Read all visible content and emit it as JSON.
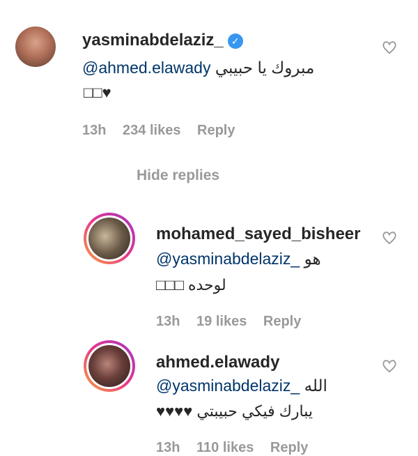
{
  "comments": [
    {
      "username": "yasminabdelaziz_",
      "verified_icon": "verified-badge-icon",
      "line1_mention": "@ahmed.elawady",
      "line1_text": "مبروك يا حبيبي",
      "line2": "□□♥",
      "time": "13h",
      "likes": "234 likes",
      "reply": "Reply"
    },
    {
      "username": "mohamed_sayed_bisheer",
      "line1_mention": "@yasminabdelaziz_",
      "line1_text": "هو",
      "line2": "□□□ لوحده",
      "time": "13h",
      "likes": "19 likes",
      "reply": "Reply"
    },
    {
      "username": "ahmed.elawady",
      "line1_mention": "@yasminabdelaziz_",
      "line1_text": "الله",
      "line2": "♥♥♥♥ يبارك فيكي حبيبتي",
      "time": "13h",
      "likes": "110 likes",
      "reply": "Reply"
    }
  ],
  "hide_replies": "Hide replies",
  "colors": {
    "mention": "#003569",
    "meta": "#999999",
    "verified": "#3897f0"
  }
}
